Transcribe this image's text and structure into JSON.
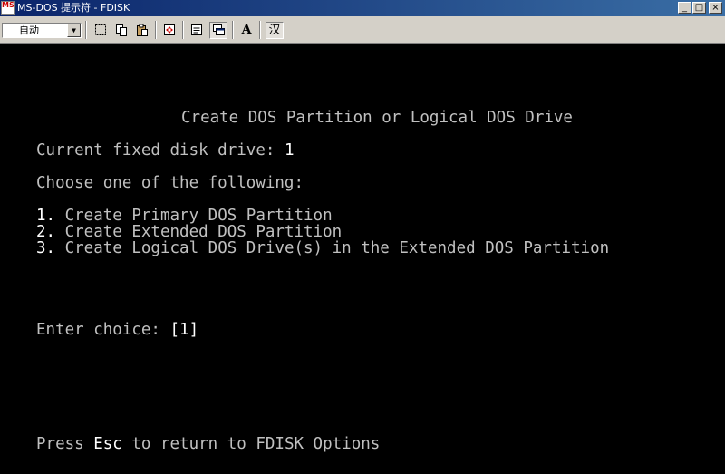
{
  "window": {
    "title": "MS-DOS 提示符 - FDISK",
    "app_icon_text": "MS",
    "controls": {
      "minimize": "_",
      "maximize": "□",
      "close": "×"
    }
  },
  "toolbar": {
    "font_select": {
      "value": "自动"
    },
    "buttons": [
      {
        "name": "mark-icon",
        "label": ""
      },
      {
        "name": "copy-icon",
        "label": ""
      },
      {
        "name": "paste-icon",
        "label": ""
      },
      {
        "name": "fullscreen-icon",
        "label": ""
      },
      {
        "name": "properties-icon",
        "label": ""
      },
      {
        "name": "background-icon",
        "label": ""
      },
      {
        "name": "font-icon",
        "label": "A"
      },
      {
        "name": "ime-icon",
        "label": "汉"
      }
    ]
  },
  "console": {
    "heading": "Create DOS Partition or Logical DOS Drive",
    "current_drive_label": "Current fixed disk drive: ",
    "current_drive_value": "1",
    "prompt_choose": "Choose one of the following:",
    "options": [
      {
        "number": "1.",
        "text": " Create Primary DOS Partition"
      },
      {
        "number": "2.",
        "text": " Create Extended DOS Partition"
      },
      {
        "number": "3.",
        "text": " Create Logical DOS Drive(s) in the Extended DOS Partition"
      }
    ],
    "enter_choice_label": "Enter choice: ",
    "choice_value": "[1]",
    "footer_press": "Press ",
    "footer_key": "Esc",
    "footer_rest": " to return to FDISK Options"
  },
  "colors": {
    "console_bg": "#000000",
    "console_text": "#c0c0c0",
    "console_highlight": "#ffffff",
    "titlebar_start": "#0a246a",
    "titlebar_end": "#3a6ea5",
    "chrome": "#d4d0c8"
  }
}
